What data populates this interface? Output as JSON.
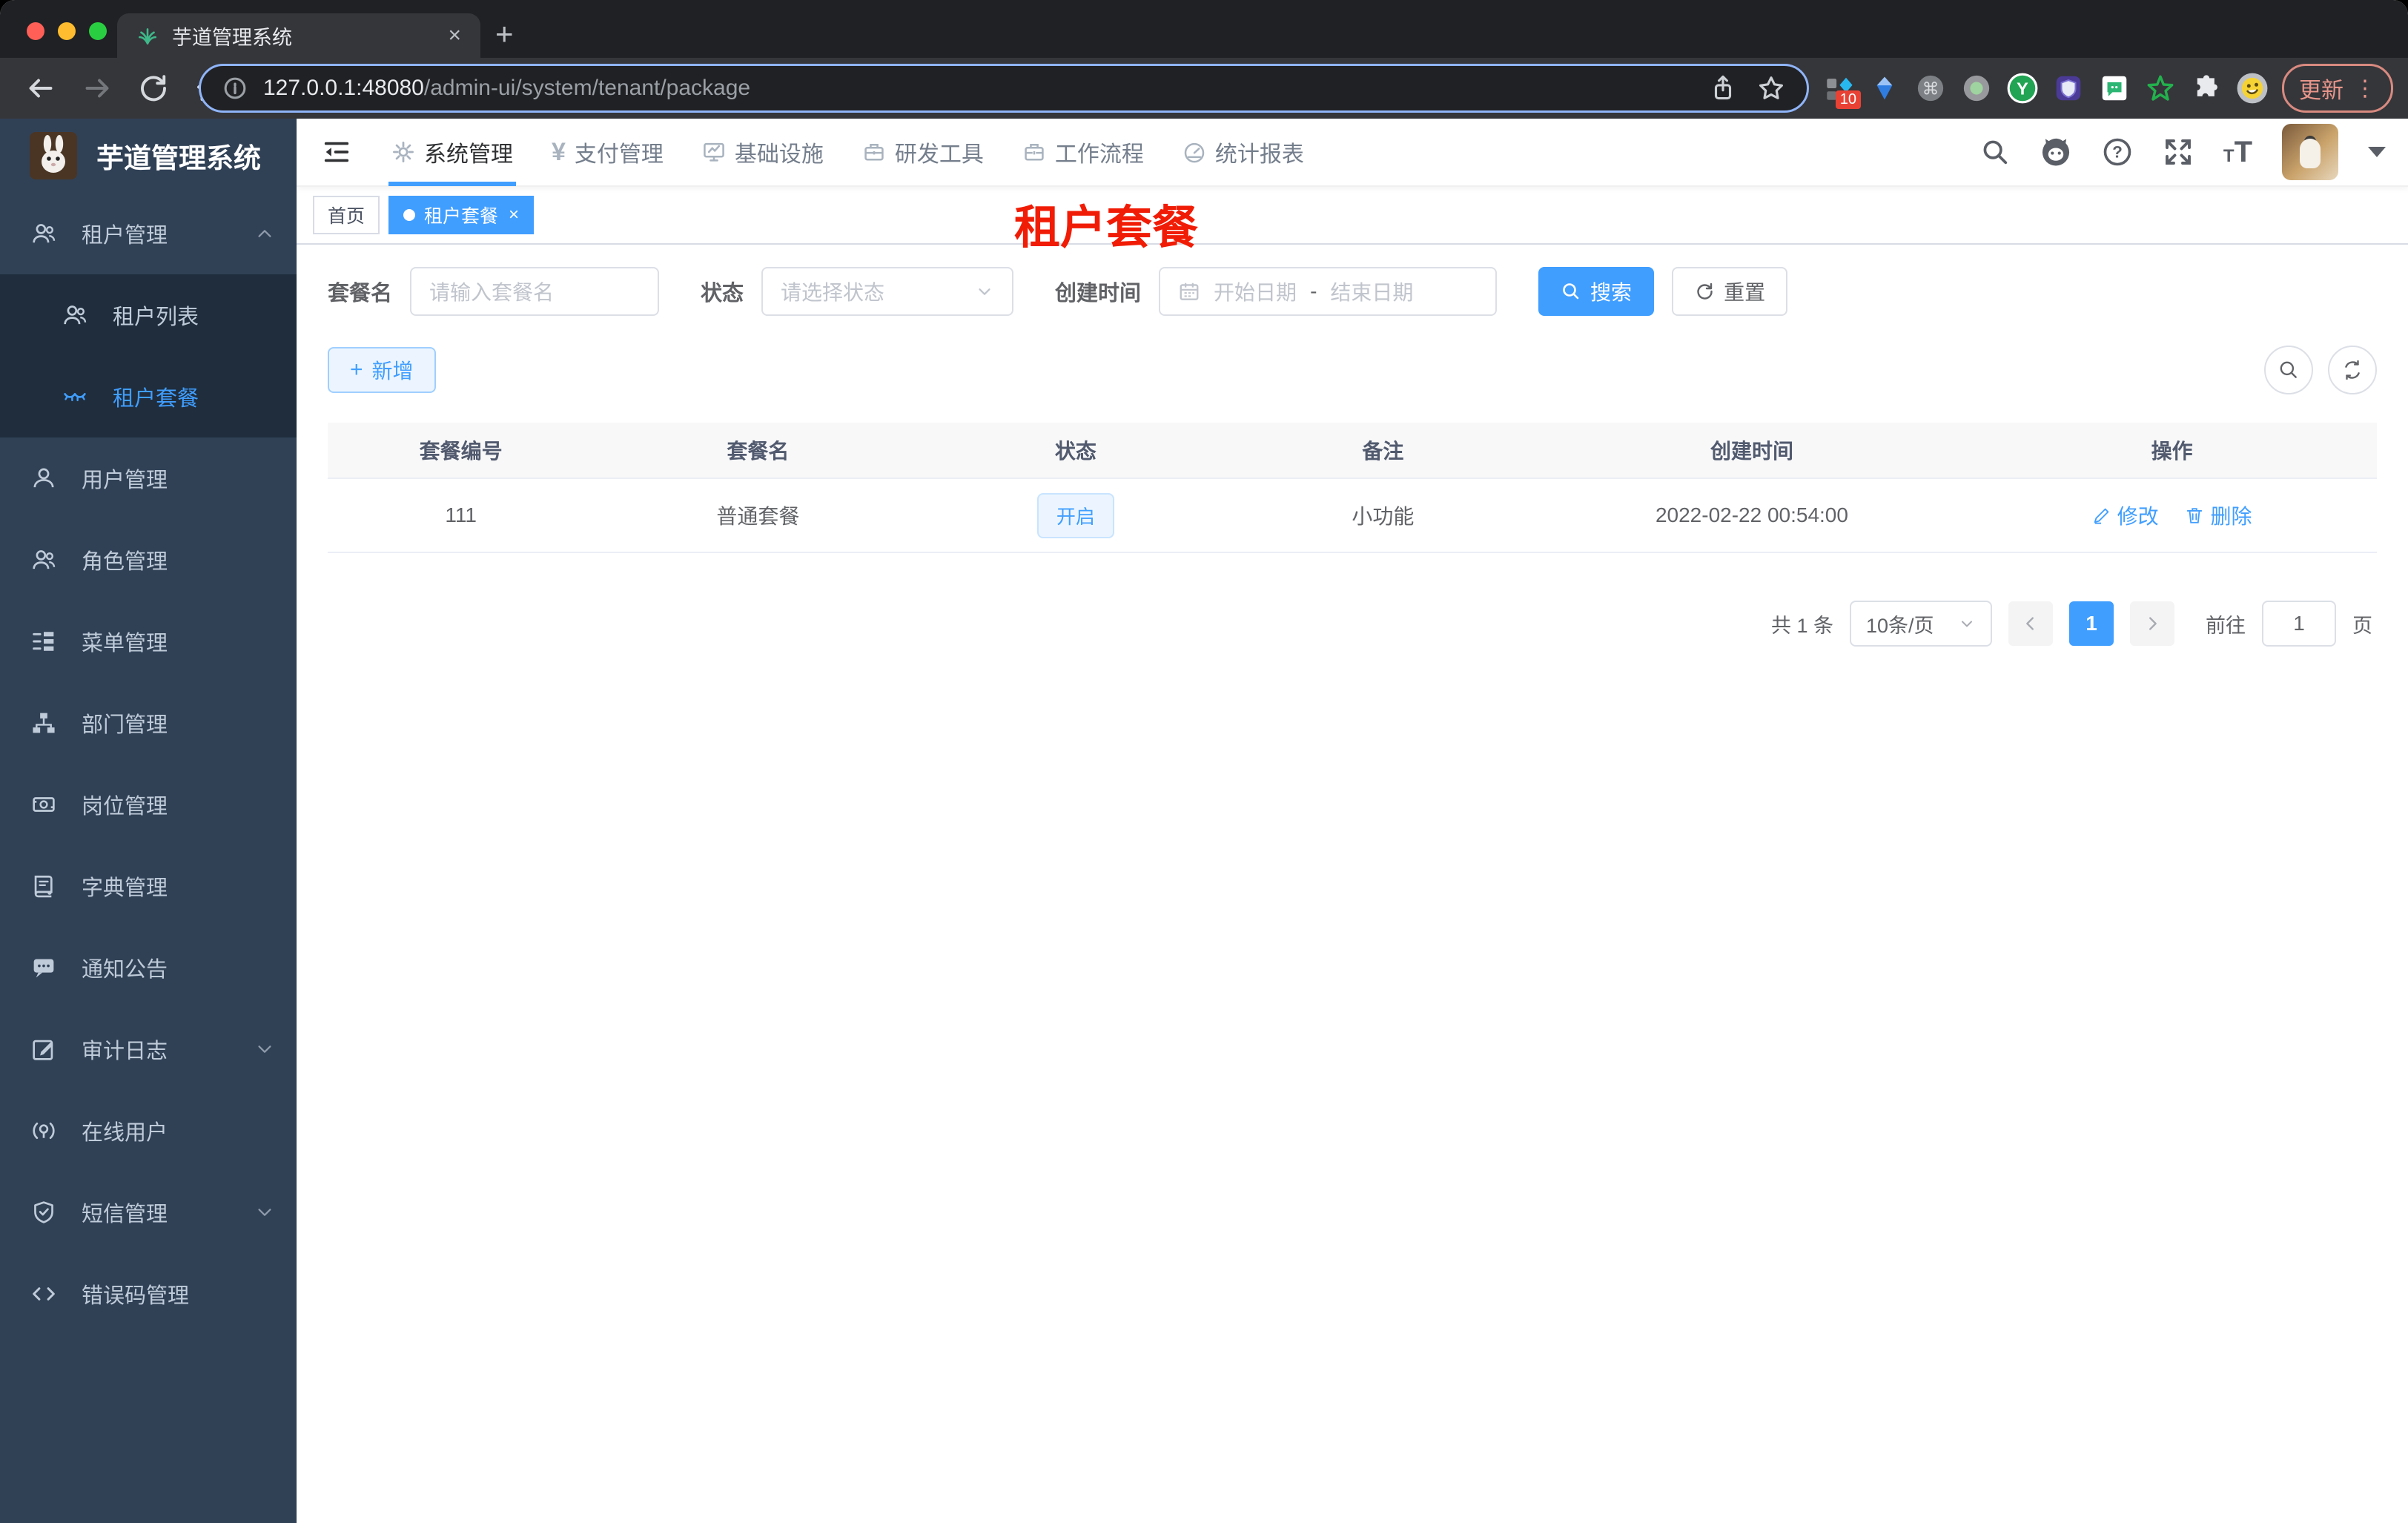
{
  "browser": {
    "tab_title": "芋道管理系统",
    "tab_close": "×",
    "new_tab": "+",
    "url_host": "127.0.0.1:48080",
    "url_path": "/admin-ui/system/tenant/package",
    "extension_badge": "10",
    "update_button": "更新",
    "menu_dots": "⋮"
  },
  "header": {
    "nav_items": [
      {
        "label": "系统管理",
        "icon": "gear-icon",
        "active": true
      },
      {
        "label": "支付管理",
        "icon": "yen-icon"
      },
      {
        "label": "基础设施",
        "icon": "monitor-icon"
      },
      {
        "label": "研发工具",
        "icon": "toolbox-icon"
      },
      {
        "label": "工作流程",
        "icon": "workflow-icon"
      },
      {
        "label": "统计报表",
        "icon": "dashboard-icon"
      }
    ]
  },
  "sidebar": {
    "logo_title": "芋道管理系统",
    "items": [
      {
        "label": "租户管理"
      },
      {
        "label": "租户列表"
      },
      {
        "label": "租户套餐",
        "active": true
      },
      {
        "label": "用户管理"
      },
      {
        "label": "角色管理"
      },
      {
        "label": "菜单管理"
      },
      {
        "label": "部门管理"
      },
      {
        "label": "岗位管理"
      },
      {
        "label": "字典管理"
      },
      {
        "label": "通知公告"
      },
      {
        "label": "审计日志"
      },
      {
        "label": "在线用户"
      },
      {
        "label": "短信管理"
      },
      {
        "label": "错误码管理"
      }
    ]
  },
  "tags": {
    "home": "首页",
    "active": "租户套餐",
    "close": "×"
  },
  "annotation": {
    "title": "租户套餐",
    "color": "#f11c06"
  },
  "filters": {
    "name_label": "套餐名",
    "name_placeholder": "请输入套餐名",
    "status_label": "状态",
    "status_placeholder": "请选择状态",
    "date_label": "创建时间",
    "date_start_placeholder": "开始日期",
    "date_separator": "-",
    "date_end_placeholder": "结束日期",
    "search_button": "搜索",
    "reset_button": "重置"
  },
  "toolbar": {
    "add_button": "新增"
  },
  "table": {
    "headers": [
      "套餐编号",
      "套餐名",
      "状态",
      "备注",
      "创建时间",
      "操作"
    ],
    "rows": [
      {
        "id": "111",
        "name": "普通套餐",
        "status": "开启",
        "remark": "小功能",
        "created_at": "2022-02-22 00:54:00",
        "edit": "修改",
        "delete": "删除"
      }
    ]
  },
  "pagination": {
    "total": "共 1 条",
    "page_size": "10条/页",
    "current_page": "1",
    "goto_label": "前往",
    "goto_value": "1",
    "unit": "页"
  },
  "colors": {
    "primary": "#409eff",
    "sidebar_bg": "#304156",
    "submenu_bg": "#1f2d3d",
    "annotation_red": "#f11c06"
  }
}
